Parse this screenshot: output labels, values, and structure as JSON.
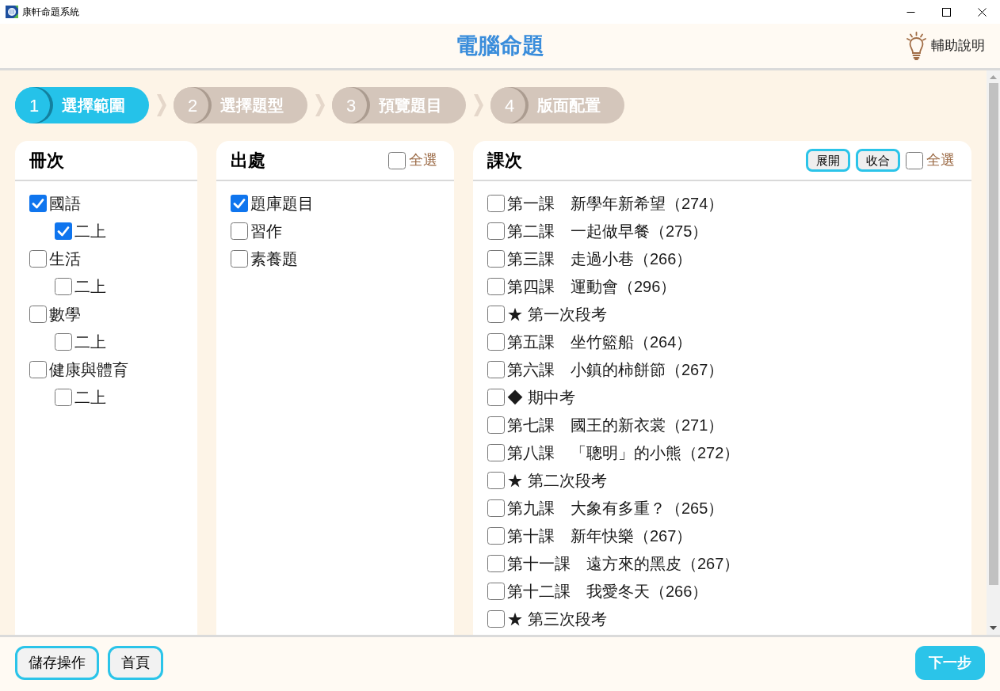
{
  "window": {
    "title": "康軒命題系統"
  },
  "header": {
    "title": "電腦命題",
    "help": "輔助說明"
  },
  "steps": [
    {
      "number": "1",
      "label": "選擇範圍",
      "selected": true
    },
    {
      "number": "2",
      "label": "選擇題型",
      "selected": false
    },
    {
      "number": "3",
      "label": "預覽題目",
      "selected": false
    },
    {
      "number": "4",
      "label": "版面配置",
      "selected": false
    }
  ],
  "volumes": {
    "title": "冊次",
    "items": [
      {
        "label": "國語",
        "checked": true,
        "children": [
          {
            "label": "二上",
            "checked": true
          }
        ]
      },
      {
        "label": "生活",
        "checked": false,
        "children": [
          {
            "label": "二上",
            "checked": false
          }
        ]
      },
      {
        "label": "數學",
        "checked": false,
        "children": [
          {
            "label": "二上",
            "checked": false
          }
        ]
      },
      {
        "label": "健康與體育",
        "checked": false,
        "children": [
          {
            "label": "二上",
            "checked": false
          }
        ]
      }
    ]
  },
  "sources": {
    "title": "出處",
    "select_all": {
      "label": "全選",
      "checked": false
    },
    "items": [
      {
        "label": "題庫題目",
        "checked": true
      },
      {
        "label": "習作",
        "checked": false
      },
      {
        "label": "素養題",
        "checked": false
      }
    ]
  },
  "lessons": {
    "title": "課次",
    "buttons": [
      "展開",
      "收合"
    ],
    "select_all": {
      "label": "全選",
      "checked": false
    },
    "items": [
      {
        "label": "第一課　新學年新希望（274）",
        "checked": false
      },
      {
        "label": "第二課　一起做早餐（275）",
        "checked": false
      },
      {
        "label": "第三課　走過小巷（266）",
        "checked": false
      },
      {
        "label": "第四課　運動會（296）",
        "checked": false
      },
      {
        "label": "★ 第一次段考",
        "checked": false
      },
      {
        "label": "第五課　坐竹籃船（264）",
        "checked": false
      },
      {
        "label": "第六課　小鎮的柿餅節（267）",
        "checked": false
      },
      {
        "label": "◆ 期中考",
        "checked": false
      },
      {
        "label": "第七課　國王的新衣裳（271）",
        "checked": false
      },
      {
        "label": "第八課　「聰明」的小熊（272）",
        "checked": false
      },
      {
        "label": "★ 第二次段考",
        "checked": false
      },
      {
        "label": "第九課　大象有多重？（265）",
        "checked": false
      },
      {
        "label": "第十課　新年快樂（267）",
        "checked": false
      },
      {
        "label": "第十一課　遠方來的黑皮（267）",
        "checked": false
      },
      {
        "label": "第十二課　我愛冬天（266）",
        "checked": false
      },
      {
        "label": "★ 第三次段考",
        "checked": false
      }
    ]
  },
  "footer": {
    "buttons": [
      "儲存操作",
      "首頁"
    ],
    "next": "下一步"
  }
}
